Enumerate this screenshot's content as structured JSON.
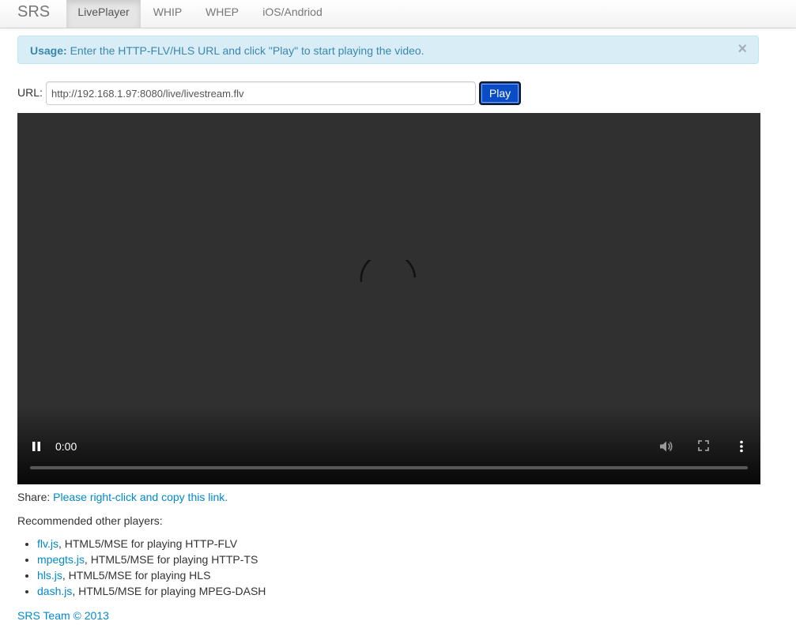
{
  "nav": {
    "brand": "SRS",
    "items": [
      {
        "label": "LivePlayer",
        "active": true
      },
      {
        "label": "WHIP",
        "active": false
      },
      {
        "label": "WHEP",
        "active": false
      },
      {
        "label": "iOS/Andriod",
        "active": false
      }
    ]
  },
  "alert": {
    "bold": "Usage:",
    "text": " Enter the HTTP-FLV/HLS URL and click \"Play\" to start playing the video.",
    "close": "×"
  },
  "url_form": {
    "label": "URL:",
    "value": "http://192.168.1.97:8080/live/livestream.flv",
    "play_label": "Play"
  },
  "video": {
    "time": "0:00",
    "icons": [
      "pause-icon",
      "volume-icon",
      "fullscreen-icon",
      "more-options-icon",
      "loading-spinner-icon"
    ]
  },
  "share": {
    "label": "Share:",
    "link": "Please right-click and copy this link."
  },
  "recommended": {
    "title": "Recommended other players:",
    "players": [
      {
        "name": "flv.js",
        "desc": ", HTML5/MSE for playing HTTP-FLV"
      },
      {
        "name": "mpegts.js",
        "desc": ", HTML5/MSE for playing HTTP-TS"
      },
      {
        "name": "hls.js",
        "desc": ", HTML5/MSE for playing HLS"
      },
      {
        "name": "dash.js",
        "desc": ", HTML5/MSE for playing MPEG-DASH"
      }
    ]
  },
  "footer": {
    "copyright": "SRS Team © 2013"
  },
  "colors": {
    "link": "#0088cc",
    "play_button": "#0a4bc6",
    "alert_bg": "#d9edf7",
    "video_bg": "#303030"
  }
}
